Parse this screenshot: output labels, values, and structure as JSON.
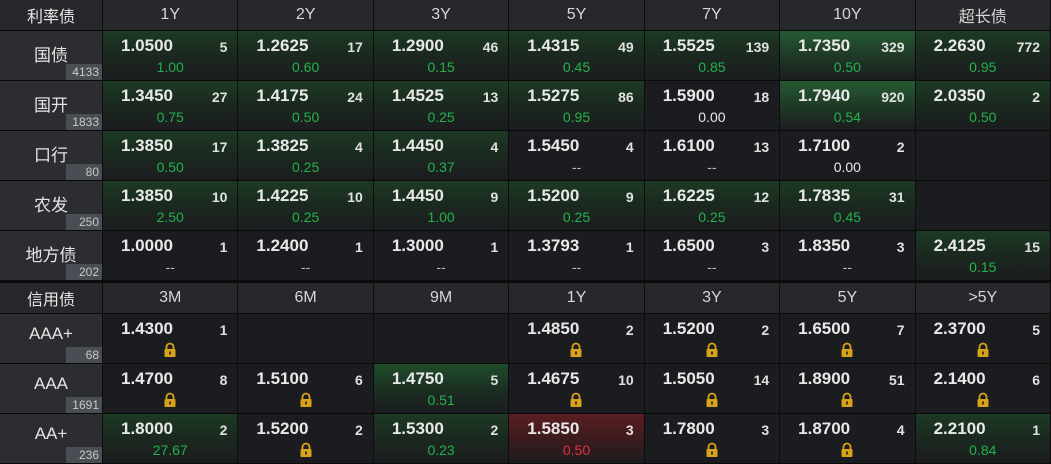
{
  "rates": {
    "header": [
      "利率债",
      "1Y",
      "2Y",
      "3Y",
      "5Y",
      "7Y",
      "10Y",
      "超长债"
    ],
    "rows": [
      {
        "name": "国债",
        "count": "4133",
        "cells": [
          {
            "price": "1.0500",
            "vol": "5",
            "chg": "1.00",
            "chg_type": "up",
            "hl": "g1"
          },
          {
            "price": "1.2625",
            "vol": "17",
            "chg": "0.60",
            "chg_type": "up",
            "hl": "g1"
          },
          {
            "price": "1.2900",
            "vol": "46",
            "chg": "0.15",
            "chg_type": "up",
            "hl": "g1"
          },
          {
            "price": "1.4315",
            "vol": "49",
            "chg": "0.45",
            "chg_type": "up",
            "hl": "g1"
          },
          {
            "price": "1.5525",
            "vol": "139",
            "chg": "0.85",
            "chg_type": "up",
            "hl": "g1"
          },
          {
            "price": "1.7350",
            "vol": "329",
            "chg": "0.50",
            "chg_type": "up",
            "hl": "g2"
          },
          {
            "price": "2.2630",
            "vol": "772",
            "chg": "0.95",
            "chg_type": "up",
            "hl": "g1"
          }
        ]
      },
      {
        "name": "国开",
        "count": "1833",
        "cells": [
          {
            "price": "1.3450",
            "vol": "27",
            "chg": "0.75",
            "chg_type": "up",
            "hl": "g1"
          },
          {
            "price": "1.4175",
            "vol": "24",
            "chg": "0.50",
            "chg_type": "up",
            "hl": "g1"
          },
          {
            "price": "1.4525",
            "vol": "13",
            "chg": "0.25",
            "chg_type": "up",
            "hl": "g1"
          },
          {
            "price": "1.5275",
            "vol": "86",
            "chg": "0.95",
            "chg_type": "up",
            "hl": "g1"
          },
          {
            "price": "1.5900",
            "vol": "18",
            "chg": "0.00",
            "chg_type": "flat",
            "hl": ""
          },
          {
            "price": "1.7940",
            "vol": "920",
            "chg": "0.54",
            "chg_type": "up",
            "hl": "g2"
          },
          {
            "price": "2.0350",
            "vol": "2",
            "chg": "0.50",
            "chg_type": "up",
            "hl": "g1"
          }
        ]
      },
      {
        "name": "口行",
        "count": "80",
        "cells": [
          {
            "price": "1.3850",
            "vol": "17",
            "chg": "0.50",
            "chg_type": "up",
            "hl": "g1"
          },
          {
            "price": "1.3825",
            "vol": "4",
            "chg": "0.25",
            "chg_type": "up",
            "hl": "g1"
          },
          {
            "price": "1.4450",
            "vol": "4",
            "chg": "0.37",
            "chg_type": "up",
            "hl": "g1"
          },
          {
            "price": "1.5450",
            "vol": "4",
            "chg": "--",
            "chg_type": "dash",
            "hl": ""
          },
          {
            "price": "1.6100",
            "vol": "13",
            "chg": "--",
            "chg_type": "dash",
            "hl": ""
          },
          {
            "price": "1.7100",
            "vol": "2",
            "chg": "0.00",
            "chg_type": "flat",
            "hl": ""
          },
          null
        ]
      },
      {
        "name": "农发",
        "count": "250",
        "cells": [
          {
            "price": "1.3850",
            "vol": "10",
            "chg": "2.50",
            "chg_type": "up",
            "hl": "g1"
          },
          {
            "price": "1.4225",
            "vol": "10",
            "chg": "0.25",
            "chg_type": "up",
            "hl": "g1"
          },
          {
            "price": "1.4450",
            "vol": "9",
            "chg": "1.00",
            "chg_type": "up",
            "hl": "g1"
          },
          {
            "price": "1.5200",
            "vol": "9",
            "chg": "0.25",
            "chg_type": "up",
            "hl": "g1"
          },
          {
            "price": "1.6225",
            "vol": "12",
            "chg": "0.25",
            "chg_type": "up",
            "hl": "g1"
          },
          {
            "price": "1.7835",
            "vol": "31",
            "chg": "0.45",
            "chg_type": "up",
            "hl": "g1"
          },
          null
        ]
      },
      {
        "name": "地方债",
        "count": "202",
        "cells": [
          {
            "price": "1.0000",
            "vol": "1",
            "chg": "--",
            "chg_type": "dash",
            "hl": ""
          },
          {
            "price": "1.2400",
            "vol": "1",
            "chg": "--",
            "chg_type": "dash",
            "hl": ""
          },
          {
            "price": "1.3000",
            "vol": "1",
            "chg": "--",
            "chg_type": "dash",
            "hl": ""
          },
          {
            "price": "1.3793",
            "vol": "1",
            "chg": "--",
            "chg_type": "dash",
            "hl": ""
          },
          {
            "price": "1.6500",
            "vol": "3",
            "chg": "--",
            "chg_type": "dash",
            "hl": ""
          },
          {
            "price": "1.8350",
            "vol": "3",
            "chg": "--",
            "chg_type": "dash",
            "hl": ""
          },
          {
            "price": "2.4125",
            "vol": "15",
            "chg": "0.15",
            "chg_type": "up",
            "hl": "g1"
          }
        ]
      }
    ]
  },
  "credit": {
    "header": [
      "信用债",
      "3M",
      "6M",
      "9M",
      "1Y",
      "3Y",
      "5Y",
      ">5Y"
    ],
    "rows": [
      {
        "name": "AAA+",
        "count": "68",
        "cells": [
          {
            "price": "1.4300",
            "vol": "1",
            "chg": "lock",
            "chg_type": "lock",
            "hl": ""
          },
          null,
          null,
          {
            "price": "1.4850",
            "vol": "2",
            "chg": "lock",
            "chg_type": "lock",
            "hl": ""
          },
          {
            "price": "1.5200",
            "vol": "2",
            "chg": "lock",
            "chg_type": "lock",
            "hl": ""
          },
          {
            "price": "1.6500",
            "vol": "7",
            "chg": "lock",
            "chg_type": "lock",
            "hl": ""
          },
          {
            "price": "2.3700",
            "vol": "5",
            "chg": "lock",
            "chg_type": "lock",
            "hl": ""
          }
        ]
      },
      {
        "name": "AAA",
        "count": "1691",
        "cells": [
          {
            "price": "1.4700",
            "vol": "8",
            "chg": "lock",
            "chg_type": "lock",
            "hl": ""
          },
          {
            "price": "1.5100",
            "vol": "6",
            "chg": "lock",
            "chg_type": "lock",
            "hl": ""
          },
          {
            "price": "1.4750",
            "vol": "5",
            "chg": "0.51",
            "chg_type": "up",
            "hl": "g3"
          },
          {
            "price": "1.4675",
            "vol": "10",
            "chg": "lock",
            "chg_type": "lock",
            "hl": ""
          },
          {
            "price": "1.5050",
            "vol": "14",
            "chg": "lock",
            "chg_type": "lock",
            "hl": ""
          },
          {
            "price": "1.8900",
            "vol": "51",
            "chg": "lock",
            "chg_type": "lock",
            "hl": ""
          },
          {
            "price": "2.1400",
            "vol": "6",
            "chg": "lock",
            "chg_type": "lock",
            "hl": ""
          }
        ]
      },
      {
        "name": "AA+",
        "count": "236",
        "cells": [
          {
            "price": "1.8000",
            "vol": "2",
            "chg": "27.67",
            "chg_type": "up",
            "hl": "g1"
          },
          {
            "price": "1.5200",
            "vol": "2",
            "chg": "lock",
            "chg_type": "lock",
            "hl": ""
          },
          {
            "price": "1.5300",
            "vol": "2",
            "chg": "0.23",
            "chg_type": "up",
            "hl": "g1"
          },
          {
            "price": "1.5850",
            "vol": "3",
            "chg": "0.50",
            "chg_type": "down",
            "hl": "r1"
          },
          {
            "price": "1.7800",
            "vol": "3",
            "chg": "lock",
            "chg_type": "lock",
            "hl": ""
          },
          {
            "price": "1.8700",
            "vol": "4",
            "chg": "lock",
            "chg_type": "lock",
            "hl": ""
          },
          {
            "price": "2.2100",
            "vol": "1",
            "chg": "0.84",
            "chg_type": "up",
            "hl": "g1"
          }
        ]
      }
    ]
  },
  "icons": {
    "lock": "lock-icon"
  },
  "colors": {
    "up": "#22b24c",
    "down": "#e0343c",
    "lock": "#d8a21a"
  }
}
